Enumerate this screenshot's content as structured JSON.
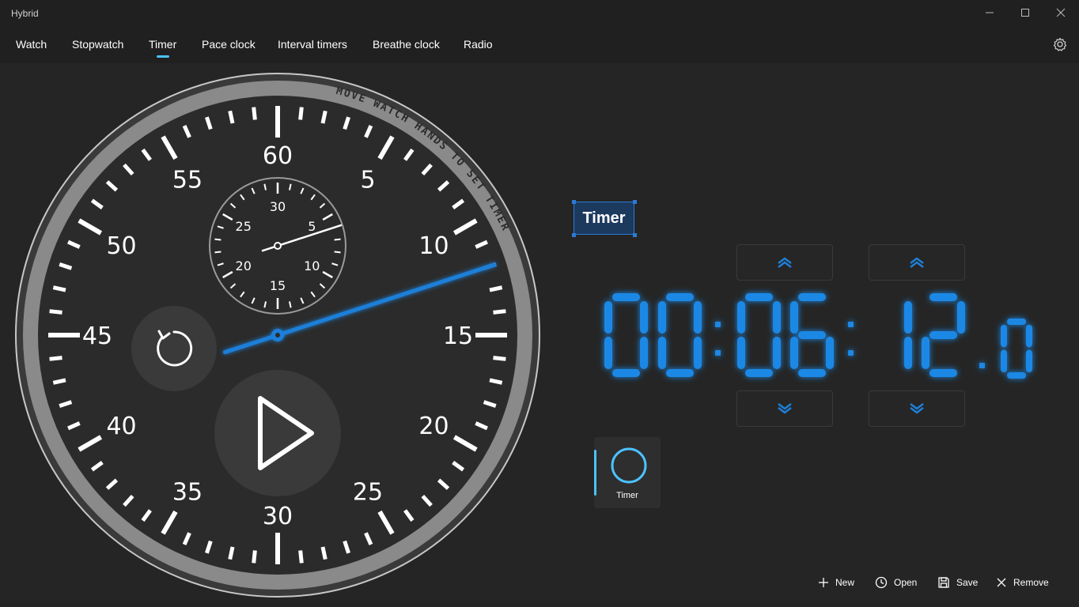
{
  "app": {
    "title": "Hybrid"
  },
  "nav": {
    "items": [
      {
        "label": "Watch"
      },
      {
        "label": "Stopwatch"
      },
      {
        "label": "Timer"
      },
      {
        "label": "Pace clock"
      },
      {
        "label": "Interval timers"
      },
      {
        "label": "Breathe clock"
      },
      {
        "label": "Radio"
      }
    ],
    "active": "Timer"
  },
  "dial": {
    "curved_text": "MOVE WATCH HANDS TO SET TIMER",
    "minute_labels": [
      "60",
      "5",
      "10",
      "15",
      "20",
      "25",
      "30",
      "35",
      "40",
      "45",
      "50",
      "55"
    ],
    "subdial_labels": [
      "30",
      "5",
      "10",
      "15",
      "20",
      "25"
    ],
    "main_hand_seconds": 12,
    "subdial_hand_minutes": 6
  },
  "timer": {
    "name": "Timer",
    "hours": "00",
    "minutes": "06",
    "seconds": "12",
    "tenths": "0",
    "digit_color": "#1e88e5"
  },
  "presets": [
    {
      "label": "Timer",
      "icon": "circle-icon"
    }
  ],
  "commands": {
    "new": "New",
    "open": "Open",
    "save": "Save",
    "remove": "Remove"
  },
  "colors": {
    "accent": "#4cc2ff",
    "hand": "#1e7fd8",
    "background": "#252525"
  }
}
